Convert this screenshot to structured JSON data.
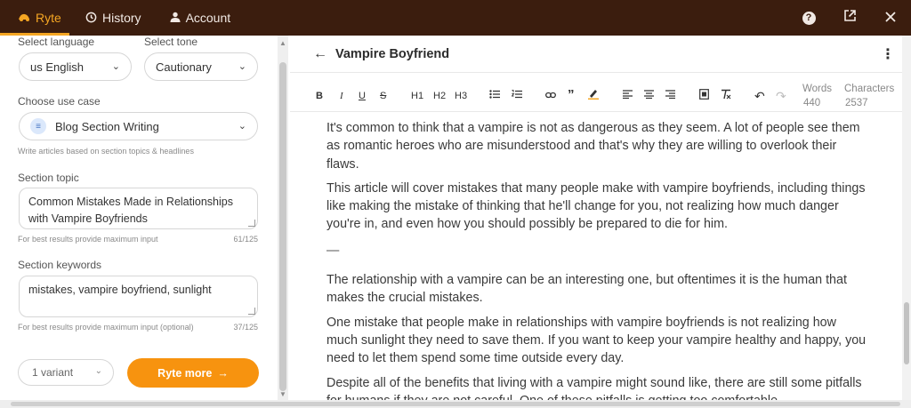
{
  "topbar": {
    "tabs": [
      {
        "label": "Ryte",
        "icon": "ryte-logo-icon"
      },
      {
        "label": "History",
        "icon": "clock-icon"
      },
      {
        "label": "Account",
        "icon": "user-icon"
      }
    ],
    "icons": [
      "help-icon",
      "open-external-icon",
      "close-icon"
    ]
  },
  "left": {
    "language_label": "Select language",
    "language_value": "us English",
    "tone_label": "Select tone",
    "tone_value": "Cautionary",
    "usecase_label": "Choose use case",
    "usecase_value": "Blog Section Writing",
    "usecase_hint": "Write articles based on section topics & headlines",
    "topic_label": "Section topic",
    "topic_value": "Common Mistakes Made in Relationships with Vampire Boyfriends",
    "topic_hint": "For best results provide maximum input",
    "topic_count": "61/125",
    "keywords_label": "Section keywords",
    "keywords_value": "mistakes, vampire boyfriend, sunlight",
    "keywords_hint": "For best results provide maximum input (optional)",
    "keywords_count": "37/125",
    "variant_value": "1 variant",
    "ryte_more_label": "Ryte more"
  },
  "editor": {
    "title": "Vampire Boyfriend",
    "toolbar": {
      "bold": "B",
      "italic": "I",
      "underline": "U",
      "strike": "S",
      "h1": "H1",
      "h2": "H2",
      "h3": "H3"
    },
    "words_label": "Words",
    "words_value": "440",
    "chars_label": "Characters",
    "chars_value": "2537",
    "paragraphs": [
      "It's common to think that a vampire is not as dangerous as they seem. A lot of people see them as romantic heroes who are misunderstood and that's why they are willing to overlook their flaws.",
      "This article will cover mistakes that many people make with vampire boyfriends, including things like making the mistake of thinking that he'll change for you, not realizing how much danger you're in, and even how you should possibly be prepared to die for him.",
      "—",
      "The relationship with a vampire can be an interesting one, but oftentimes it is the human that makes the crucial mistakes.",
      "One mistake that people make in relationships with vampire boyfriends is not realizing how much sunlight they need to save them. If you want to keep your vampire healthy and happy, you need to let them spend some time outside every day.",
      "Despite all of the benefits that living with a vampire might sound like, there are still some pitfalls for humans if they are not careful. One of these pitfalls is getting too comfortable"
    ]
  },
  "colors": {
    "topbar_bg": "#3b1d0e",
    "accent": "#f5a623",
    "button_orange": "#f7930f"
  }
}
